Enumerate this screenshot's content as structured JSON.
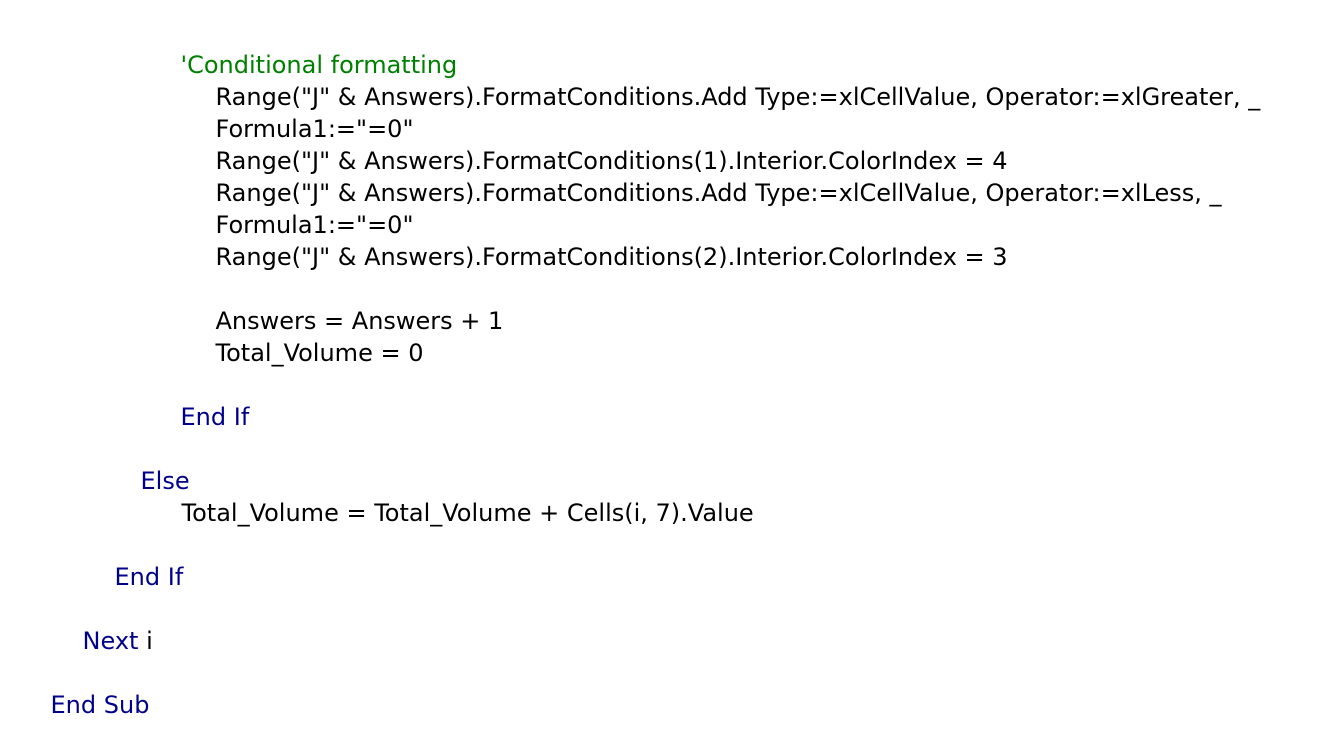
{
  "colors": {
    "keyword": "#00008b",
    "comment": "#008000",
    "plain": "#000000",
    "background": "#ffffff"
  },
  "code": {
    "lines": [
      {
        "tokens": [
          {
            "text": "'Conditional formatting",
            "kind": "comment"
          }
        ]
      },
      {
        "tokens": [
          {
            "text": "Range(\"J\" & Answers).FormatConditions.Add Type:=xlCellValue, Operator:=xlGreater, _",
            "kind": "plain"
          }
        ]
      },
      {
        "tokens": [
          {
            "text": "Formula1:=\"=0\"",
            "kind": "plain"
          }
        ]
      },
      {
        "tokens": [
          {
            "text": "Range(\"J\" & Answers).FormatConditions(1).Interior.ColorIndex = 4",
            "kind": "plain"
          }
        ]
      },
      {
        "tokens": [
          {
            "text": "Range(\"J\" & Answers).FormatConditions.Add Type:=xlCellValue, Operator:=xlLess, _",
            "kind": "plain"
          }
        ]
      },
      {
        "tokens": [
          {
            "text": "Formula1:=\"=0\"",
            "kind": "plain"
          }
        ]
      },
      {
        "tokens": [
          {
            "text": "Range(\"J\" & Answers).FormatConditions(2).Interior.ColorIndex = 3",
            "kind": "plain"
          }
        ]
      },
      {
        "tokens": [
          {
            "text": "Answers = Answers + 1",
            "kind": "plain"
          }
        ]
      },
      {
        "tokens": [
          {
            "text": "Total_Volume = 0",
            "kind": "plain"
          }
        ]
      },
      {
        "tokens": [
          {
            "text": "End If",
            "kind": "keyword"
          }
        ]
      },
      {
        "tokens": [
          {
            "text": "Else",
            "kind": "keyword"
          }
        ]
      },
      {
        "tokens": [
          {
            "text": "Total_Volume = Total_Volume + Cells(i, 7).Value",
            "kind": "plain"
          }
        ]
      },
      {
        "tokens": [
          {
            "text": "End If",
            "kind": "keyword"
          }
        ]
      },
      {
        "tokens": [
          {
            "text": "Next",
            "kind": "keyword"
          },
          {
            "text": " i",
            "kind": "plain"
          }
        ]
      },
      {
        "tokens": [
          {
            "text": "End Sub",
            "kind": "keyword"
          }
        ]
      }
    ]
  }
}
